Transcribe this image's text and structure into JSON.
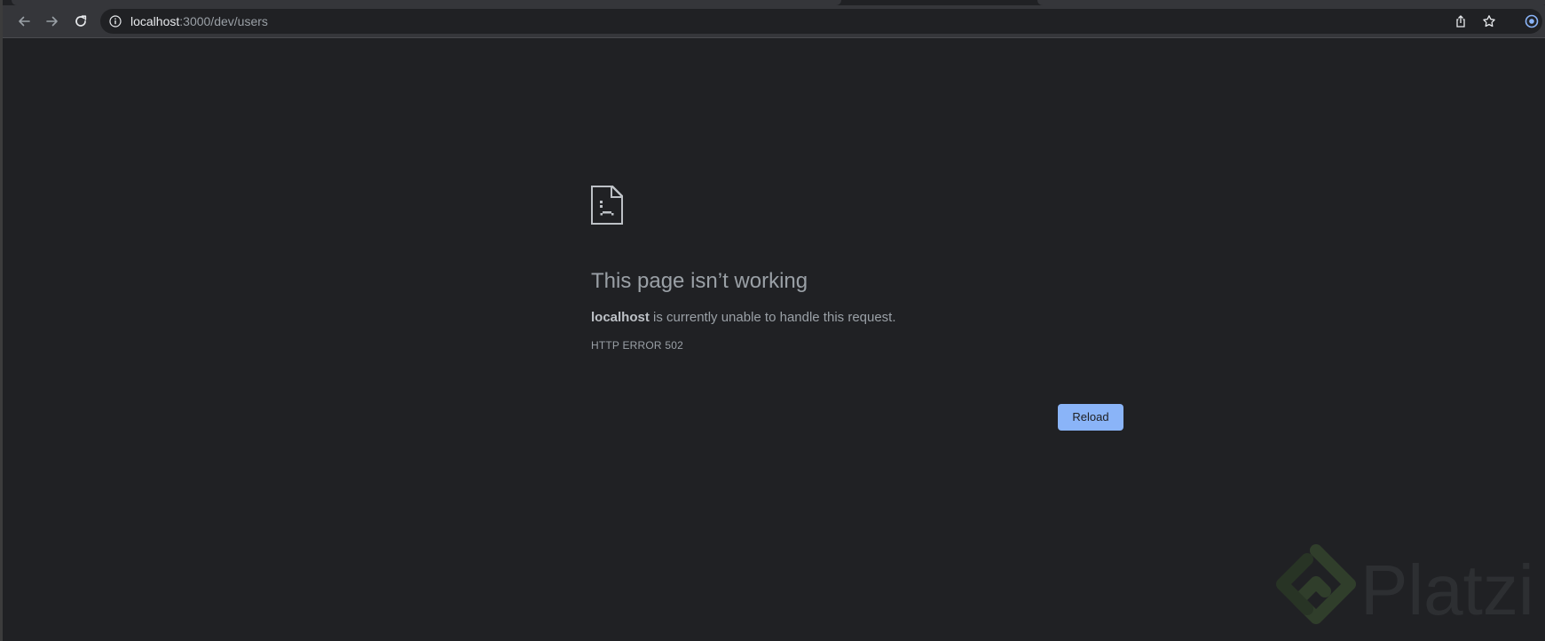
{
  "browser": {
    "address_bar": {
      "host": "localhost",
      "path": ":3000/dev/users"
    }
  },
  "icons": {
    "back": "back-arrow-icon",
    "forward": "forward-arrow-icon",
    "reload": "reload-icon",
    "site_info": "info-icon",
    "share": "share-icon",
    "bookmark": "star-icon",
    "error": "sad-page-icon"
  },
  "error_page": {
    "title": "This page isn’t working",
    "message_host": "localhost",
    "message_rest": " is currently unable to handle this request.",
    "error_code": "HTTP ERROR 502",
    "reload_label": "Reload"
  },
  "watermark": {
    "text": "Platzi"
  },
  "colors": {
    "page_background": "#202124",
    "toolbar_background": "#35363a",
    "text_secondary": "#9aa0a6",
    "accent_button": "#8ab4f8"
  }
}
